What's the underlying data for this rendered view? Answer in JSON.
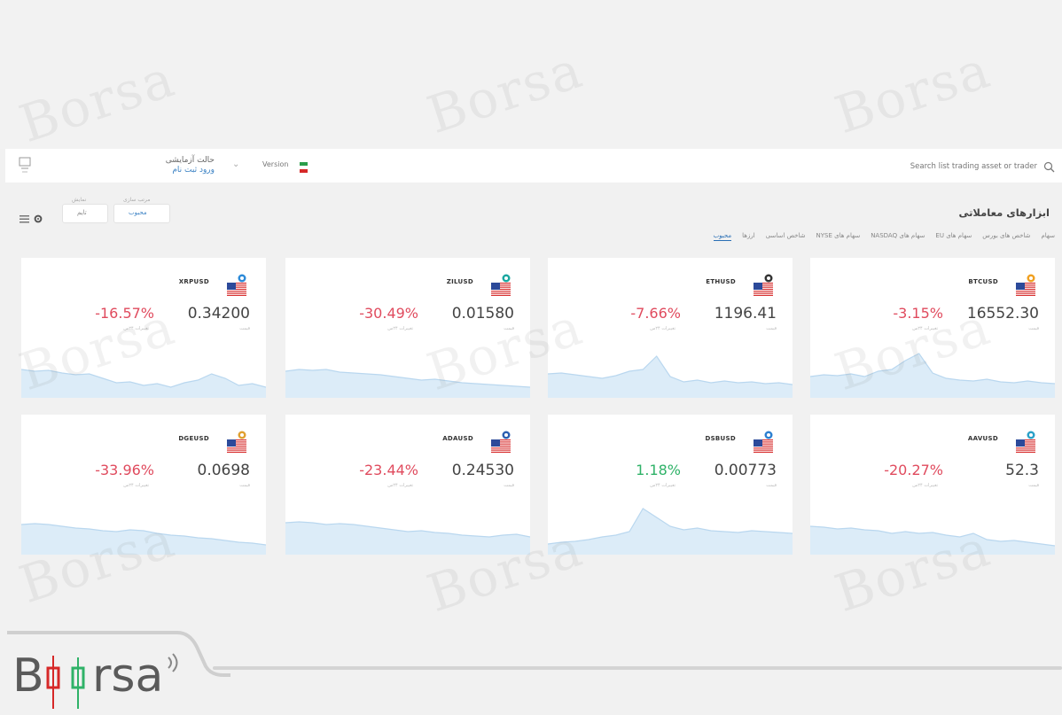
{
  "watermark": "Borsa",
  "topbar": {
    "account_line1": "حالت آزمایشی",
    "account_line2": "ورود ثبت نام",
    "version_label": "Version",
    "search_placeholder": "Search list trading asset or trader"
  },
  "filters": {
    "select1_caption": "نمایش",
    "select1_value": "تایم",
    "select2_caption": "مرتب سازی",
    "select2_value": "محبوب"
  },
  "page": {
    "title": "ابزارهای معاملاتی",
    "tabs": [
      {
        "label": "محبوب",
        "active": true
      },
      {
        "label": "ارزها",
        "active": false
      },
      {
        "label": "شاخص اساسی",
        "active": false
      },
      {
        "label": "سهام های NYSE",
        "active": false
      },
      {
        "label": "سهام های NASDAQ",
        "active": false
      },
      {
        "label": "سهام های EU",
        "active": false
      },
      {
        "label": "شاخص های بورس",
        "active": false
      },
      {
        "label": "سهام",
        "active": false
      }
    ]
  },
  "price_caption": "قیمت",
  "change_caption": "تغییرات ۲۴س",
  "cards": [
    {
      "symbol": "XRPUSD",
      "price": "0.34200",
      "change": "-16.57%",
      "direction": "negative",
      "coin_color": "#2c8ad8",
      "spark": [
        40,
        42,
        41,
        44,
        46,
        45,
        50,
        55,
        54,
        58,
        56,
        60,
        55,
        52,
        45,
        50,
        58,
        56,
        60
      ]
    },
    {
      "symbol": "ZILUSD",
      "price": "0.01580",
      "change": "-30.49%",
      "direction": "negative",
      "coin_color": "#1aa7a0",
      "spark": [
        42,
        40,
        41,
        40,
        43,
        44,
        45,
        46,
        48,
        50,
        52,
        51,
        53,
        55,
        56,
        57,
        58,
        59,
        60
      ]
    },
    {
      "symbol": "ETHUSD",
      "price": "1196.41",
      "change": "-7.66%",
      "direction": "negative",
      "coin_color": "#333333",
      "spark": [
        45,
        44,
        46,
        48,
        50,
        47,
        42,
        40,
        25,
        48,
        54,
        52,
        55,
        53,
        55,
        54,
        56,
        55,
        57
      ]
    },
    {
      "symbol": "BTCUSD",
      "price": "16552.30",
      "change": "-3.15%",
      "direction": "negative",
      "coin_color": "#f0a020",
      "spark": [
        48,
        46,
        47,
        45,
        48,
        42,
        40,
        30,
        22,
        44,
        50,
        52,
        53,
        51,
        54,
        55,
        53,
        55,
        56
      ]
    },
    {
      "symbol": "DGEUSD",
      "price": "0.0698",
      "change": "-33.96%",
      "direction": "negative",
      "coin_color": "#e0a030",
      "spark": [
        38,
        37,
        38,
        40,
        42,
        43,
        45,
        46,
        44,
        45,
        48,
        50,
        51,
        53,
        54,
        56,
        58,
        59,
        61
      ]
    },
    {
      "symbol": "ADAUSD",
      "price": "0.24530",
      "change": "-23.44%",
      "direction": "negative",
      "coin_color": "#2c5fb0",
      "spark": [
        36,
        35,
        36,
        38,
        37,
        38,
        40,
        42,
        44,
        46,
        45,
        47,
        48,
        50,
        51,
        52,
        50,
        49,
        52
      ]
    },
    {
      "symbol": "DSBUSD",
      "price": "0.00773",
      "change": "1.18%",
      "direction": "positive",
      "coin_color": "#2c7fd0",
      "spark": [
        60,
        58,
        57,
        55,
        52,
        50,
        46,
        20,
        30,
        40,
        44,
        42,
        45,
        46,
        47,
        45,
        46,
        47,
        48
      ]
    },
    {
      "symbol": "AAVUSD",
      "price": "52.3",
      "change": "-20.27%",
      "direction": "negative",
      "coin_color": "#2aa0c8",
      "spark": [
        40,
        41,
        43,
        42,
        44,
        45,
        48,
        46,
        48,
        47,
        50,
        52,
        48,
        55,
        57,
        56,
        58,
        60,
        62
      ]
    }
  ],
  "colors": {
    "accent": "#2a6fb5",
    "negative": "#e04b5e",
    "positive": "#2fb268",
    "spark_fill": "#dcecf8",
    "spark_line": "#b9d7ef"
  }
}
